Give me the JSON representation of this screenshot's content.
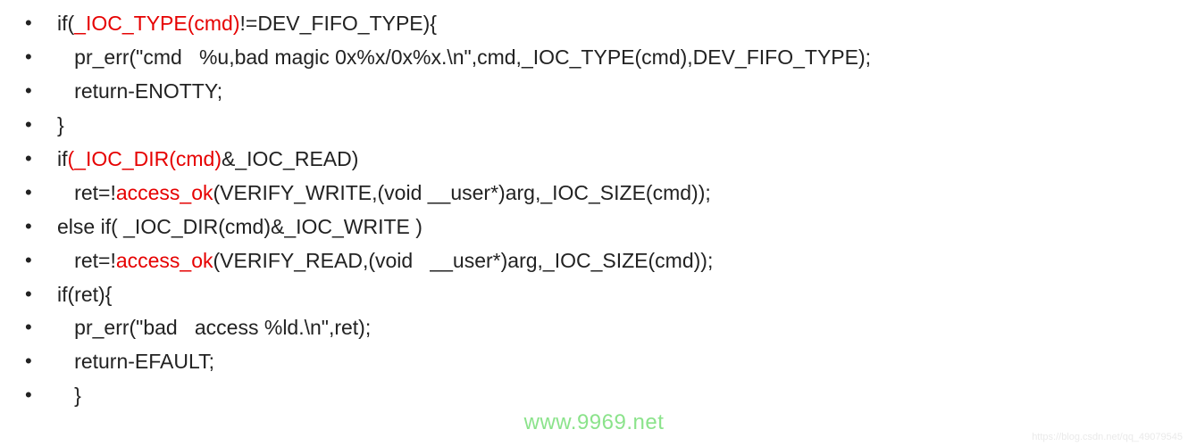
{
  "lines": [
    {
      "indent": 0,
      "segments": [
        {
          "t": "if("
        },
        {
          "t": "_IOC_TYPE(cmd)",
          "red": true
        },
        {
          "t": "!=DEV_FIFO_TYPE){"
        }
      ]
    },
    {
      "indent": 1,
      "segments": [
        {
          "t": "pr_err(\"cmd   %u,bad magic 0x%x/0x%x.\\n\",cmd,_IOC_TYPE(cmd),DEV_FIFO_TYPE);"
        }
      ]
    },
    {
      "indent": 1,
      "segments": [
        {
          "t": "return-ENOTTY;"
        }
      ]
    },
    {
      "indent": 0,
      "segments": [
        {
          "t": "}"
        }
      ]
    },
    {
      "indent": 0,
      "segments": [
        {
          "t": "if"
        },
        {
          "t": "(_IOC_DIR(cmd)",
          "red": true
        },
        {
          "t": "&_IOC_READ)"
        }
      ]
    },
    {
      "indent": 1,
      "segments": [
        {
          "t": "ret=!"
        },
        {
          "t": "access_ok",
          "red": true
        },
        {
          "t": "(VERIFY_WRITE,(void __user*)arg,_IOC_SIZE(cmd));"
        }
      ]
    },
    {
      "indent": 0,
      "segments": [
        {
          "t": "else if( _IOC_DIR(cmd)&_IOC_WRITE )"
        }
      ]
    },
    {
      "indent": 1,
      "segments": [
        {
          "t": "ret=!"
        },
        {
          "t": "access_ok",
          "red": true
        },
        {
          "t": "(VERIFY_READ,(void   __user*)arg,_IOC_SIZE(cmd));"
        }
      ]
    },
    {
      "indent": 0,
      "segments": [
        {
          "t": "if(ret){"
        }
      ]
    },
    {
      "indent": 1,
      "segments": [
        {
          "t": "pr_err(\"bad   access %ld.\\n\",ret);"
        }
      ]
    },
    {
      "indent": 1,
      "segments": [
        {
          "t": "return-EFAULT;"
        }
      ]
    },
    {
      "indent": 1,
      "segments": [
        {
          "t": "}"
        }
      ]
    }
  ],
  "watermark": "www.9969.net",
  "faint": "https://blog.csdn.net/qq_49079545"
}
